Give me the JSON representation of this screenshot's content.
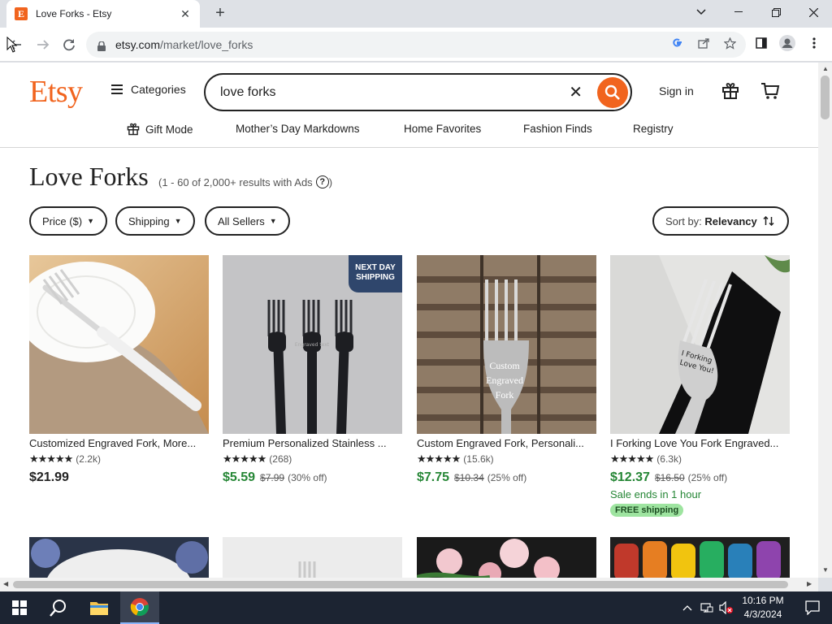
{
  "browser": {
    "tab_title": "Love Forks - Etsy",
    "tab_favicon": "E",
    "url_host": "etsy.com",
    "url_path": "/market/love_forks"
  },
  "header": {
    "logo": "Etsy",
    "categories_label": "Categories",
    "search_value": "love forks",
    "signin_label": "Sign in"
  },
  "subnav": [
    {
      "label": "Gift Mode"
    },
    {
      "label": "Mother’s Day Markdowns"
    },
    {
      "label": "Home Favorites"
    },
    {
      "label": "Fashion Finds"
    },
    {
      "label": "Registry"
    }
  ],
  "results": {
    "title": "Love Forks",
    "count_text": "(1 - 60 of 2,000+ results with Ads",
    "count_close": ")",
    "help_glyph": "?"
  },
  "filters": {
    "price": "Price ($)",
    "shipping": "Shipping",
    "sellers": "All Sellers",
    "sort_prefix": "Sort by:",
    "sort_value": "Relevancy"
  },
  "products": [
    {
      "title": "Customized Engraved Fork, More...",
      "stars": "★★★★★",
      "reviews": "(2.2k)",
      "price": "$21.99",
      "old_price": "",
      "discount": ""
    },
    {
      "title": "Premium Personalized Stainless ...",
      "stars": "★★★★★",
      "reviews": "(268)",
      "price": "$5.59",
      "old_price": "$7.99",
      "discount": "(30% off)",
      "badge": "NEXT DAY SHIPPING",
      "engraving": "Engraved text"
    },
    {
      "title": "Custom Engraved Fork, Personali...",
      "stars": "★★★★★",
      "reviews": "(15.6k)",
      "price": "$7.75",
      "old_price": "$10.34",
      "discount": "(25% off)",
      "engraving": "Custom Engraved Fork"
    },
    {
      "title": "I Forking Love You Fork Engraved...",
      "stars": "★★★★★",
      "reviews": "(6.3k)",
      "price": "$12.37",
      "old_price": "$16.50",
      "discount": "(25% off)",
      "sale_ends": "Sale ends in 1 hour",
      "shipping_badge": "FREE shipping",
      "engraving": "I Forking Love You!"
    }
  ],
  "taskbar": {
    "time": "10:16 PM",
    "date": "4/3/2024"
  },
  "colors": {
    "etsy_orange": "#f1641e",
    "sale_green": "#258635",
    "badge_navy": "#2f466c"
  }
}
